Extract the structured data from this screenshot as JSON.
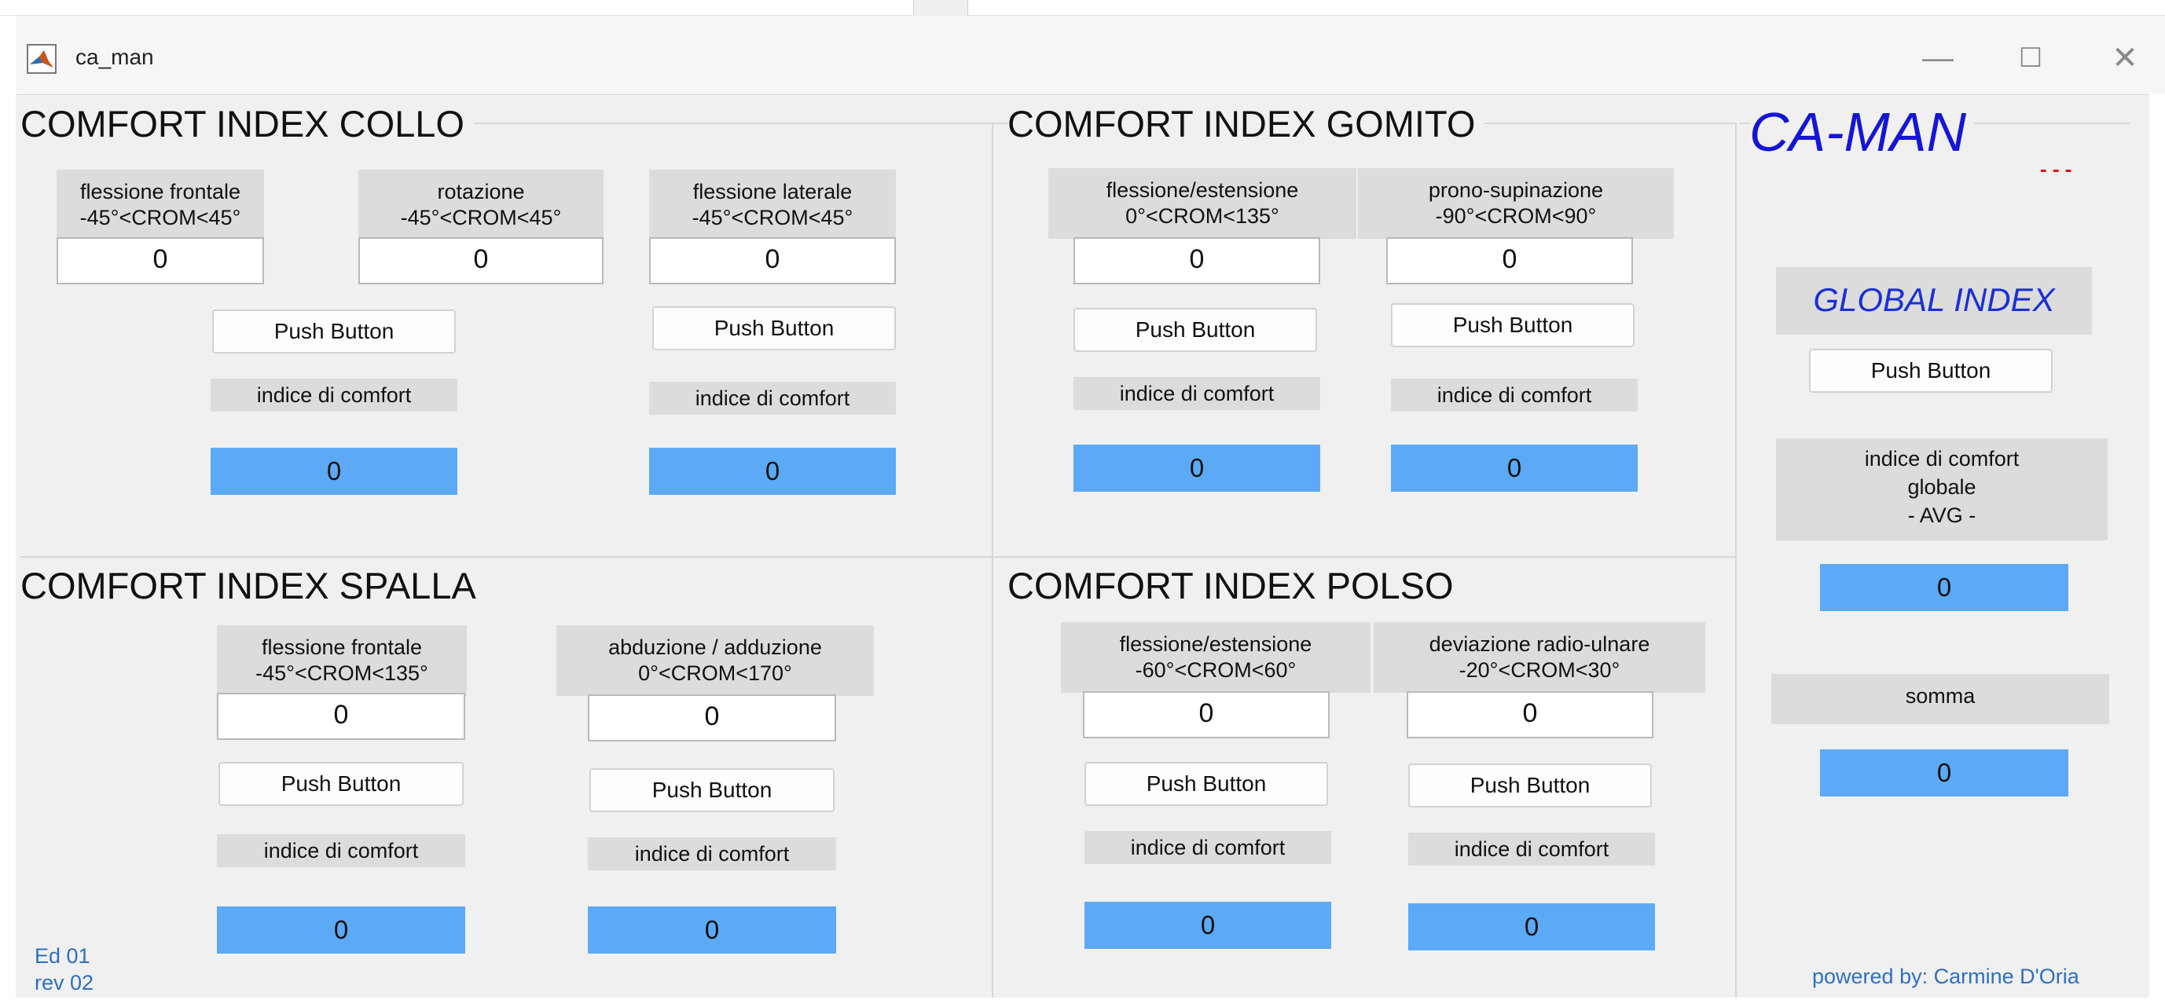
{
  "window": {
    "title": "ca_man",
    "minimize_icon": "minimize-icon",
    "maximize_icon": "maximize-icon",
    "close_icon": "close-icon",
    "minimize_glyph": "—",
    "maximize_glyph": "☐",
    "close_glyph": "✕"
  },
  "collo": {
    "title": "COMFORT INDEX COLLO",
    "fields": [
      {
        "label1": "flessione frontale",
        "label2": "-45°<CROM<45°",
        "value": "0"
      },
      {
        "label1": "rotazione",
        "label2": "-45°<CROM<45°",
        "value": "0"
      },
      {
        "label1": "flessione laterale",
        "label2": "-45°<CROM<45°",
        "value": "0"
      }
    ],
    "outputs": [
      {
        "button": "Push Button",
        "index_label": "indice di comfort",
        "value": "0"
      },
      {
        "button": "Push Button",
        "index_label": "indice di comfort",
        "value": "0"
      }
    ]
  },
  "gomito": {
    "title": "COMFORT INDEX GOMITO",
    "fields": [
      {
        "label1": "flessione/estensione",
        "label2": "0°<CROM<135°",
        "value": "0"
      },
      {
        "label1": "prono-supinazione",
        "label2": "-90°<CROM<90°",
        "value": "0"
      }
    ],
    "outputs": [
      {
        "button": "Push Button",
        "index_label": "indice di comfort",
        "value": "0"
      },
      {
        "button": "Push Button",
        "index_label": "indice di comfort",
        "value": "0"
      }
    ]
  },
  "spalla": {
    "title": "COMFORT INDEX SPALLA",
    "fields": [
      {
        "label1": "flessione frontale",
        "label2": "-45°<CROM<135°",
        "value": "0"
      },
      {
        "label1": "abduzione / adduzione",
        "label2": "0°<CROM<170°",
        "value": "0"
      }
    ],
    "outputs": [
      {
        "button": "Push Button",
        "index_label": "indice di comfort",
        "value": "0"
      },
      {
        "button": "Push Button",
        "index_label": "indice di comfort",
        "value": "0"
      }
    ]
  },
  "polso": {
    "title": "COMFORT INDEX POLSO",
    "fields": [
      {
        "label1": "flessione/estensione",
        "label2": "-60°<CROM<60°",
        "value": "0"
      },
      {
        "label1": "deviazione radio-ulnare",
        "label2": "-20°<CROM<30°",
        "value": "0"
      }
    ],
    "outputs": [
      {
        "button": "Push Button",
        "index_label": "indice di comfort",
        "value": "0"
      },
      {
        "button": "Push Button",
        "index_label": "indice di comfort",
        "value": "0"
      }
    ]
  },
  "sidebar": {
    "title": "CA-MAN",
    "global_label": "GLOBAL INDEX",
    "button": "Push Button",
    "avg_label1": "indice di comfort",
    "avg_label2": "globale",
    "avg_label3": "- AVG -",
    "avg_value": "0",
    "sum_label": "somma",
    "sum_value": "0",
    "powered_by": "powered by: Carmine D'Oria"
  },
  "footer": {
    "ed": "Ed 01",
    "rev": "rev 02"
  },
  "colors": {
    "value_box": "#5caaf5",
    "title_accent": "#1515d6",
    "footer_text": "#2f6fc0"
  }
}
